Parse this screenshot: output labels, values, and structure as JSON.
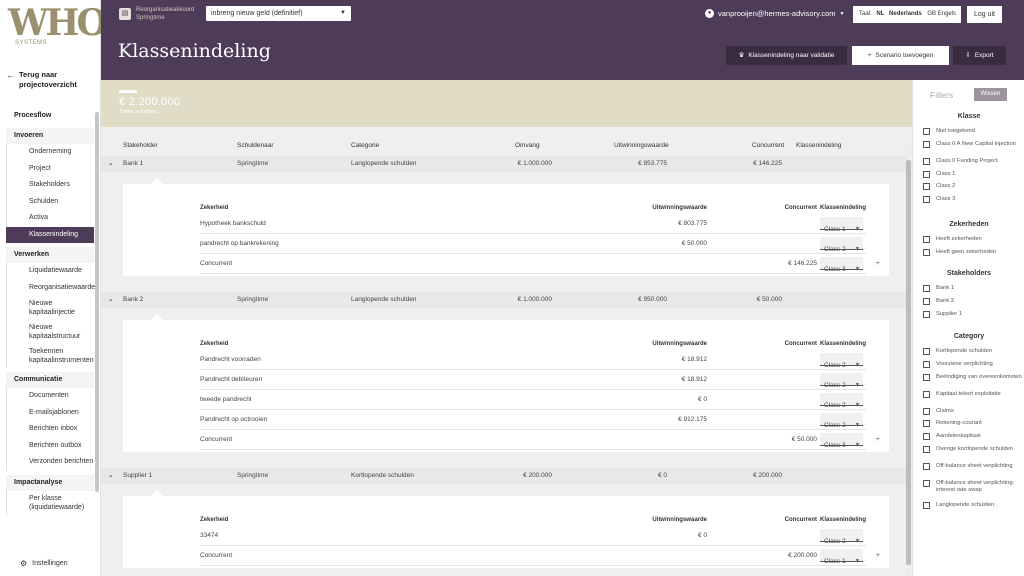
{
  "sidebar": {
    "logo": "WHOA",
    "logo_sub": "SYSTEMS",
    "back": "Terug naar projectoverzicht",
    "procesflow": "Procesflow",
    "sections": [
      {
        "title": "Invoeren",
        "items": [
          "Onderneming",
          "Project",
          "Stakeholders",
          "Schulden",
          "Activa",
          "Klassenindeling"
        ]
      },
      {
        "title": "Verwerken",
        "items": [
          "Liquidatiewaarde",
          "Reorganisatiewaarde",
          "Nieuwe kapitaalinjectie",
          "Nieuwe kapitaalstructuur",
          "Toekennen kapitaalinstrumenten"
        ]
      },
      {
        "title": "Communicatie",
        "items": [
          "Documenten",
          "E-mailsjablonen",
          "Berichten inbox",
          "Berichten outbox",
          "Verzonden berichten"
        ]
      },
      {
        "title": "Impactanalyse",
        "items": [
          "Per klasse (liquidatiewaarde)"
        ]
      }
    ],
    "active": "Klassenindeling",
    "settings": "Instellingen"
  },
  "header": {
    "project_label": "Reorganisatieakkoord",
    "project_name": "Springtime",
    "scenario": "inbreng nieuw geld (definitief)",
    "user": "vanprooijen@hermes-advisory.com",
    "lang_label": "Taal:",
    "lang_nl": "Nederlands",
    "lang_en": "Engels",
    "logout": "Log uit",
    "title": "Klassenindeling",
    "btn_validate": "Klassenindeling naar validatie",
    "btn_add": "Scenario toevoegen",
    "btn_export": "Export"
  },
  "summary": {
    "amount": "€ 2.200.000",
    "label": "Totale schulden"
  },
  "columns": [
    "Stakeholder",
    "Schuldenaar",
    "Categorie",
    "Omvang",
    "Uitwinningswaarde",
    "Concurrent",
    "Klassenindeling"
  ],
  "panel_headers": {
    "zekerheid": "Zekerheid",
    "uitwinning": "Uitwinningswaarde",
    "concurrent": "Concurrent",
    "klasse": "Klassenindeling"
  },
  "groups": [
    {
      "stakeholder": "Bank 1",
      "schuldenaar": "Springtime",
      "categorie": "Langlopende schulden",
      "omvang": "€ 1.000.000",
      "uitwinning": "€ 853.775",
      "concurrent": "€ 146.225",
      "rows": [
        {
          "zekerheid": "Hypotheek bankschuld",
          "uitwinning": "€ 803.775",
          "concurrent": "",
          "klasse": "Class 1"
        },
        {
          "zekerheid": "pandrecht op bankrekening",
          "uitwinning": "€ 50.000",
          "concurrent": "",
          "klasse": "Class 2"
        },
        {
          "zekerheid": "Concurrent",
          "uitwinning": "",
          "concurrent": "€ 146.225",
          "klasse": "Class 3"
        }
      ]
    },
    {
      "stakeholder": "Bank 2",
      "schuldenaar": "Springtime",
      "categorie": "Langlopende schulden",
      "omvang": "€ 1.000.000",
      "uitwinning": "€ 950.000",
      "concurrent": "€ 50.000",
      "rows": [
        {
          "zekerheid": "Pandrecht voorraden",
          "uitwinning": "€ 18.912",
          "concurrent": "",
          "klasse": "Class 2"
        },
        {
          "zekerheid": "Pandrecht debiteuren",
          "uitwinning": "€ 18.912",
          "concurrent": "",
          "klasse": "Class 2"
        },
        {
          "zekerheid": "tweede pandrecht",
          "uitwinning": "€ 0",
          "concurrent": "",
          "klasse": "Class 2"
        },
        {
          "zekerheid": "Pandrecht op octrooien",
          "uitwinning": "€ 912.175",
          "concurrent": "",
          "klasse": "Class 2"
        },
        {
          "zekerheid": "Concurrent",
          "uitwinning": "",
          "concurrent": "€ 50.000",
          "klasse": "Class 3"
        }
      ]
    },
    {
      "stakeholder": "Supplier 1",
      "schuldenaar": "Springtime",
      "categorie": "Kortlopende schulden",
      "omvang": "€ 200.000",
      "uitwinning": "€ 0",
      "concurrent": "€ 200.000",
      "rows": [
        {
          "zekerheid": "33474",
          "uitwinning": "€ 0",
          "concurrent": "",
          "klasse": "Class 2"
        },
        {
          "zekerheid": "Concurrent",
          "uitwinning": "",
          "concurrent": "€ 200.000",
          "klasse": "Class 1"
        }
      ]
    }
  ],
  "filters": {
    "title": "Filters",
    "clear": "Wissen",
    "klasse": {
      "title": "Klasse",
      "options": [
        "Niet toegekend",
        "Class 0 A New Capital injection",
        "Class 0 Funding Project",
        "Class 1",
        "Class 2",
        "Class 3"
      ]
    },
    "zekerheden": {
      "title": "Zekerheden",
      "options": [
        "Heeft zekerheden",
        "Heeft geen zekerheden"
      ]
    },
    "stakeholders": {
      "title": "Stakeholders",
      "options": [
        "Bank 1",
        "Bank 2",
        "Supplier 1"
      ]
    },
    "category": {
      "title": "Category",
      "options": [
        "Kortlopende schulden",
        "Voorziene verplichting",
        "Beëindiging van overeenkomsten",
        "Kapitaal tekort exploitatie",
        "Claims",
        "Rekening-courant",
        "Aandelenkapitaal",
        "Overige kortlopende schulden",
        "Off-balance sheet verplichting",
        "Off-balance sheet verplichting: interest rate swap",
        "Langlopende schulden"
      ]
    }
  }
}
